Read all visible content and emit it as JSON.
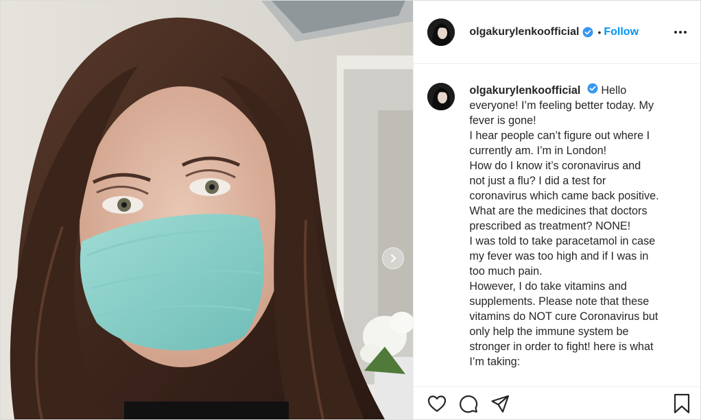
{
  "post": {
    "username": "olgakurylenkoofficial",
    "verified": true,
    "separator": "•",
    "follow_label": "Follow",
    "more_icon": "more-horizontal-icon",
    "caption_first": "Hello",
    "caption_lines": [
      "everyone! I’m feeling better today. My",
      "fever is gone!",
      "I hear people can’t figure out where I",
      "currently am. I’m in London!",
      "How do I know it’s coronavirus and",
      "not just a flu? I did a test for",
      "coronavirus which came back positive.",
      "What are the medicines that doctors",
      "prescribed as treatment? NONE!",
      "I was told to take paracetamol in case",
      "my fever was too high and if I was in",
      "too much pain.",
      "However, I do take vitamins and",
      "supplements. Please note that these",
      "vitamins do NOT cure Coronavirus but",
      "only help the immune system be",
      "stronger in order to fight! here is what",
      "I’m taking:"
    ],
    "action_icons": [
      "heart-icon",
      "comment-icon",
      "share-icon",
      "bookmark-icon"
    ],
    "colors": {
      "link": "#0095f6",
      "verified": "#3897f0",
      "text": "#262626",
      "border": "#dbdbdb"
    }
  }
}
